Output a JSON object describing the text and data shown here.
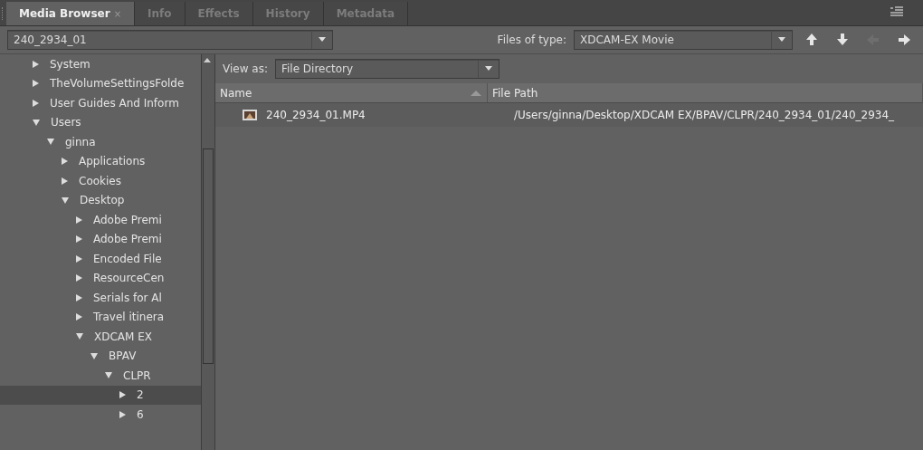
{
  "tabs": [
    {
      "label": "Media Browser",
      "selected": true,
      "close": "×"
    },
    {
      "label": "Info",
      "selected": false
    },
    {
      "label": "Effects",
      "selected": false
    },
    {
      "label": "History",
      "selected": false
    },
    {
      "label": "Metadata",
      "selected": false
    }
  ],
  "location": {
    "value": "240_2934_01"
  },
  "files_of_type": {
    "label": "Files of type:",
    "value": "XDCAM-EX Movie"
  },
  "nav_buttons": [
    {
      "kind": "up",
      "disabled": false
    },
    {
      "kind": "down",
      "disabled": false
    },
    {
      "kind": "back",
      "disabled": true
    },
    {
      "kind": "forward",
      "disabled": false
    }
  ],
  "tree": [
    {
      "label": "System",
      "expanded": false,
      "selected": false
    },
    {
      "label": "TheVolumeSettingsFolde",
      "expanded": false,
      "selected": false
    },
    {
      "label": "User Guides And Inform",
      "expanded": false,
      "selected": false
    },
    {
      "label": "Users",
      "expanded": true,
      "selected": false,
      "children": [
        {
          "label": "ginna",
          "expanded": true,
          "selected": false,
          "children": [
            {
              "label": "Applications",
              "expanded": false,
              "selected": false
            },
            {
              "label": "Cookies",
              "expanded": false,
              "selected": false
            },
            {
              "label": "Desktop",
              "expanded": true,
              "selected": false,
              "children": [
                {
                  "label": "Adobe Premi",
                  "expanded": false,
                  "selected": false
                },
                {
                  "label": "Adobe Premi",
                  "expanded": false,
                  "selected": false
                },
                {
                  "label": "Encoded File",
                  "expanded": false,
                  "selected": false
                },
                {
                  "label": "ResourceCen",
                  "expanded": false,
                  "selected": false
                },
                {
                  "label": "Serials for Al",
                  "expanded": false,
                  "selected": false
                },
                {
                  "label": "Travel itinera",
                  "expanded": false,
                  "selected": false
                },
                {
                  "label": "XDCAM EX",
                  "expanded": true,
                  "selected": false,
                  "children": [
                    {
                      "label": "BPAV",
                      "expanded": true,
                      "selected": false,
                      "children": [
                        {
                          "label": "CLPR",
                          "expanded": true,
                          "selected": false,
                          "children": [
                            {
                              "label": "2",
                              "expanded": false,
                              "selected": true
                            },
                            {
                              "label": "6",
                              "expanded": false,
                              "selected": false
                            }
                          ]
                        }
                      ]
                    }
                  ]
                }
              ]
            }
          ]
        }
      ]
    }
  ],
  "view_as": {
    "label": "View as:",
    "value": "File Directory"
  },
  "table": {
    "columns": [
      {
        "label": "Name",
        "sorted": true
      },
      {
        "label": "File Path",
        "sorted": false
      }
    ],
    "rows": [
      {
        "name": "240_2934_01.MP4",
        "path": "/Users/ginna/Desktop/XDCAM EX/BPAV/CLPR/240_2934_01/240_2934_"
      }
    ]
  }
}
